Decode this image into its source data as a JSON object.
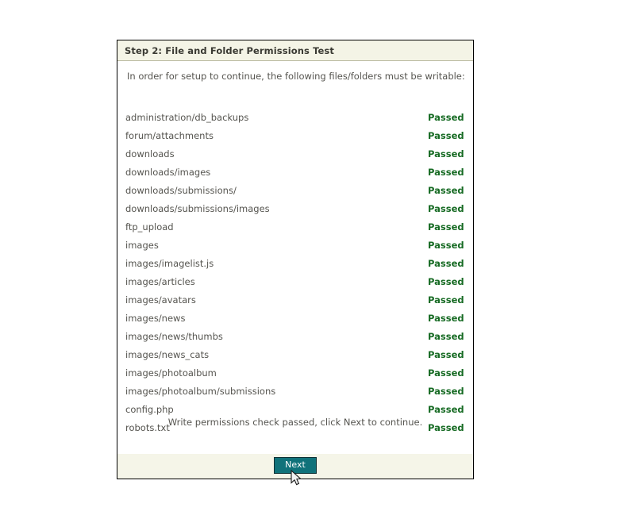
{
  "panel": {
    "header_title": "Step 2: File and Folder Permissions Test",
    "intro_text": "In order for setup to continue, the following files/folders must be writable:",
    "summary_text": "Write permissions check passed, click Next to continue.",
    "next_label": "Next",
    "cursor_icon": "arrow-pointer-icon",
    "colors": {
      "header_background": "#f4f4e6",
      "footer_background": "#f5f5e8",
      "panel_border": "#000000",
      "status_passed": "#176b24",
      "body_text": "#55544f",
      "button_background": "#10727a",
      "button_border": "#0b2f33",
      "button_text": "#ffffff"
    }
  },
  "permissions": [
    {
      "path": "administration/db_backups",
      "status": "Passed"
    },
    {
      "path": "forum/attachments",
      "status": "Passed"
    },
    {
      "path": "downloads",
      "status": "Passed"
    },
    {
      "path": "downloads/images",
      "status": "Passed"
    },
    {
      "path": "downloads/submissions/",
      "status": "Passed"
    },
    {
      "path": "downloads/submissions/images",
      "status": "Passed"
    },
    {
      "path": "ftp_upload",
      "status": "Passed"
    },
    {
      "path": "images",
      "status": "Passed"
    },
    {
      "path": "images/imagelist.js",
      "status": "Passed"
    },
    {
      "path": "images/articles",
      "status": "Passed"
    },
    {
      "path": "images/avatars",
      "status": "Passed"
    },
    {
      "path": "images/news",
      "status": "Passed"
    },
    {
      "path": "images/news/thumbs",
      "status": "Passed"
    },
    {
      "path": "images/news_cats",
      "status": "Passed"
    },
    {
      "path": "images/photoalbum",
      "status": "Passed"
    },
    {
      "path": "images/photoalbum/submissions",
      "status": "Passed"
    },
    {
      "path": "config.php",
      "status": "Passed"
    },
    {
      "path": "robots.txt",
      "status": "Passed"
    }
  ]
}
